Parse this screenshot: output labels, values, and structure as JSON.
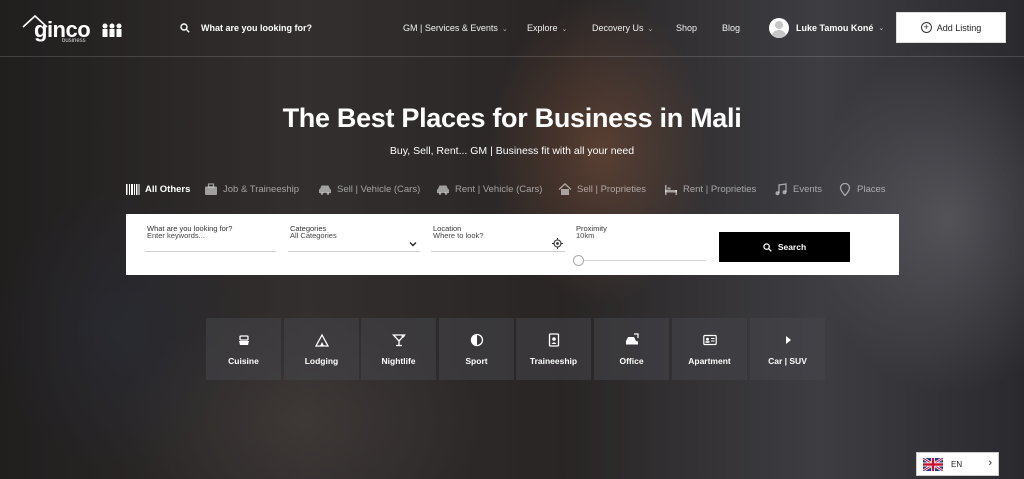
{
  "header": {
    "logo_text": "ginco",
    "logo_sub": "business",
    "search_label": "What are you looking for?",
    "nav": [
      {
        "label": "GM | Services & Events",
        "has_dropdown": true
      },
      {
        "label": "Explore",
        "has_dropdown": true
      },
      {
        "label": "Decovery Us",
        "has_dropdown": true
      },
      {
        "label": "Shop",
        "has_dropdown": false
      },
      {
        "label": "Blog",
        "has_dropdown": false
      }
    ],
    "user_name": "Luke Tamou Koné",
    "add_listing_label": "Add Listing"
  },
  "hero": {
    "title": "The Best Places for Business in Mali",
    "subtitle": "Buy, Sell, Rent... GM | Business fit with all your need"
  },
  "categories": [
    {
      "label": "All Others",
      "icon": "barcode-icon",
      "active": true
    },
    {
      "label": "Job & Traineeship",
      "icon": "briefcase-icon",
      "active": false
    },
    {
      "label": "Sell | Vehicle (Cars)",
      "icon": "car-icon",
      "active": false
    },
    {
      "label": "Rent | Vehicle (Cars)",
      "icon": "car-icon",
      "active": false
    },
    {
      "label": "Sell | Proprieties",
      "icon": "house-icon",
      "active": false
    },
    {
      "label": "Rent | Proprieties",
      "icon": "bed-icon",
      "active": false
    },
    {
      "label": "Events",
      "icon": "music-icon",
      "active": false
    },
    {
      "label": "Places",
      "icon": "map-pin-icon",
      "active": false
    }
  ],
  "search_form": {
    "keywords": {
      "label": "What are you looking for?",
      "placeholder": "Enter keywords..."
    },
    "categories": {
      "label": "Categories",
      "value": "All Categories"
    },
    "location": {
      "label": "Location",
      "placeholder": "Where to look?"
    },
    "proximity": {
      "label": "Proximity",
      "value": "10km",
      "level": 0
    },
    "search_button": "Search"
  },
  "tiles": [
    {
      "label": "Cuisine",
      "icon": "cuisine-icon"
    },
    {
      "label": "Lodging",
      "icon": "tent-icon"
    },
    {
      "label": "Nightlife",
      "icon": "cocktail-icon"
    },
    {
      "label": "Sport",
      "icon": "half-circle-icon"
    },
    {
      "label": "Traineeship",
      "icon": "id-badge-icon"
    },
    {
      "label": "Office",
      "icon": "car-tag-icon"
    },
    {
      "label": "Apartment",
      "icon": "id-card-icon"
    },
    {
      "label": "Car | SUV",
      "icon": "play-icon"
    }
  ],
  "language": {
    "code": "EN",
    "flag": "uk-flag-icon"
  },
  "colors": {
    "button_dark": "#000000",
    "panel_bg": "#ffffff"
  }
}
